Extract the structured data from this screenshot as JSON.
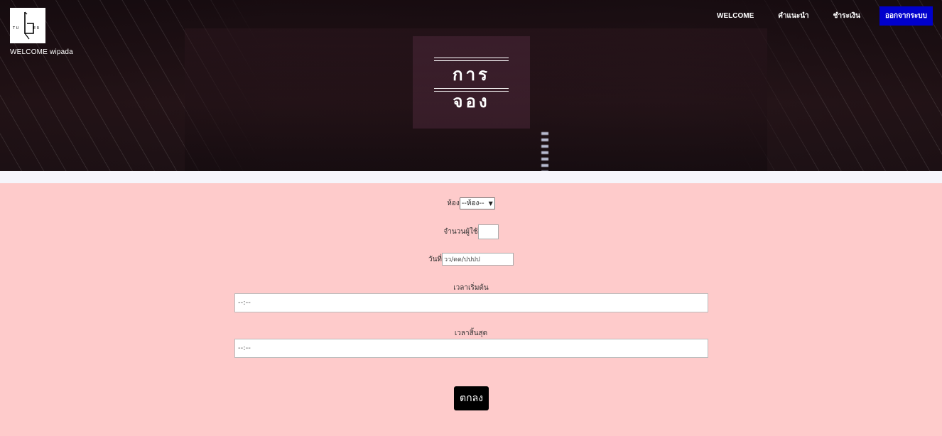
{
  "header": {
    "welcome_text": "WELCOME wipada",
    "logo_text": "TUBER",
    "page_title": "การจอง"
  },
  "nav": {
    "items": [
      {
        "label": "WELCOME"
      },
      {
        "label": "คำแนะนำ"
      },
      {
        "label": "ชำระเงิน"
      }
    ],
    "logout_label": "ออกจากระบบ",
    "logout_color": "#0000cc"
  },
  "form": {
    "room_label": "ห้อง",
    "room_selected": "--ห้อง--",
    "users_label": "จำนวนผู้ใช้",
    "users_value": "",
    "date_label": "วันที่",
    "date_placeholder": "วว/ดด/ปปปป",
    "start_label": "เวลาเริ่มต้น",
    "start_value": "--:--",
    "end_label": "เวลาสิ้นสุด",
    "end_value": "--:--",
    "submit_label": "ตกลง"
  },
  "colors": {
    "page_background": "#fecbcb",
    "submit_background": "#000000"
  }
}
